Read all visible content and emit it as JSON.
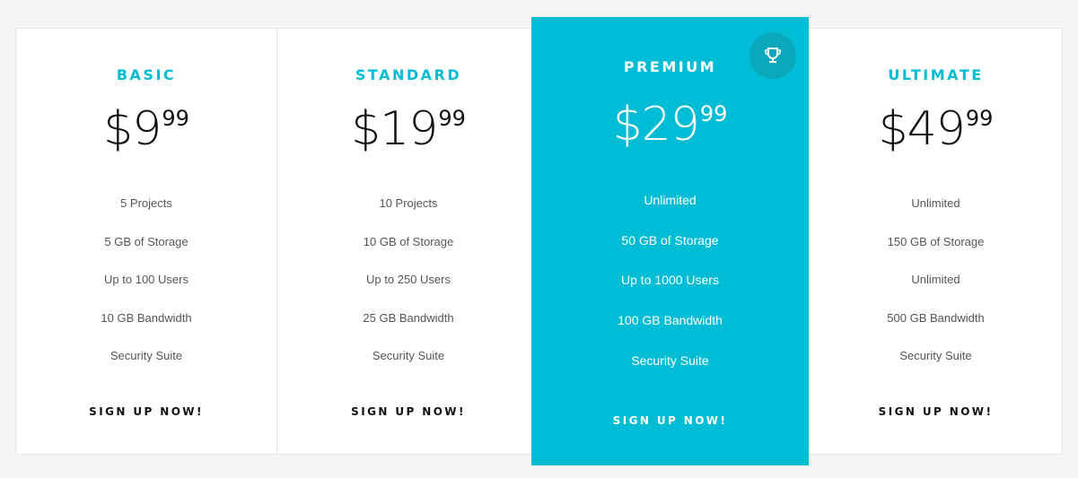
{
  "colors": {
    "accent": "#00bcd4",
    "background": "#f4f4f4",
    "card": "#ffffff"
  },
  "plans": [
    {
      "name": "BASIC",
      "price": {
        "dollars": "$9",
        "cents": "99"
      },
      "features": [
        "5 Projects",
        "5 GB of Storage",
        "Up to 100 Users",
        "10 GB Bandwidth",
        "Security Suite"
      ],
      "cta": "SIGN UP NOW!"
    },
    {
      "name": "STANDARD",
      "price": {
        "dollars": "$19",
        "cents": "99"
      },
      "features": [
        "10 Projects",
        "10 GB of Storage",
        "Up to 250 Users",
        "25 GB Bandwidth",
        "Security Suite"
      ],
      "cta": "SIGN UP NOW!"
    },
    {
      "name": "PREMIUM",
      "featured": true,
      "icon": "trophy-icon",
      "price": {
        "dollars": "$29",
        "cents": "99"
      },
      "features": [
        "Unlimited",
        "50 GB of Storage",
        "Up to 1000 Users",
        "100 GB Bandwidth",
        "Security Suite"
      ],
      "cta": "SIGN UP NOW!"
    },
    {
      "name": "ULTIMATE",
      "price": {
        "dollars": "$49",
        "cents": "99"
      },
      "features": [
        "Unlimited",
        "150 GB of Storage",
        "Unlimited",
        "500 GB Bandwidth",
        "Security Suite"
      ],
      "cta": "SIGN UP NOW!"
    }
  ]
}
